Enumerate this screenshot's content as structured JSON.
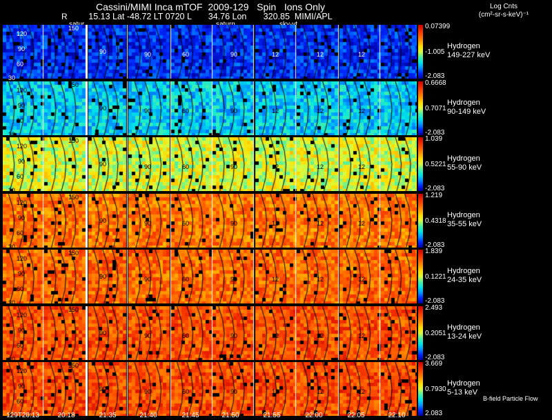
{
  "header": {
    "title": "Cassini/MIMI Inca mTOF  2009-129   Spin   Ions Only",
    "subtitle": "15.13 Lat -48.72 LT 0720 L       34.76 Lon       320.85  MIMI/APL",
    "r_label": "R",
    "units": "Log Cnts",
    "units2": "(cm²-sr-s-keV)⁻¹"
  },
  "markers": [
    "satur",
    "saturn",
    "sky-vt"
  ],
  "panels": [
    {
      "species": "Hydrogen",
      "energy": "149-227 keV",
      "max": "0.07399",
      "mid": "-1.005",
      "min": "-2.083",
      "level": 0.12
    },
    {
      "species": "Hydrogen",
      "energy": "90-149 keV",
      "max": "0.6668",
      "mid": "0.7071",
      "min": "-2.083",
      "level": 0.32
    },
    {
      "species": "Hydrogen",
      "energy": "55-90 keV",
      "max": "1.039",
      "mid": "0.5221",
      "min": "-2.083",
      "level": 0.56
    },
    {
      "species": "Hydrogen",
      "energy": "35-55 keV",
      "max": "1.219",
      "mid": "0.4318",
      "min": "-2.083",
      "level": 0.78
    },
    {
      "species": "Hydrogen",
      "energy": "24-35 keV",
      "max": "1.839",
      "mid": "0.1221",
      "min": "-2.083",
      "level": 0.8
    },
    {
      "species": "Hydrogen",
      "energy": "13-24 keV",
      "max": "2.493",
      "mid": "0.2051",
      "min": "-2.083",
      "level": 0.84
    },
    {
      "species": "Hydrogen",
      "energy": "5-13 keV",
      "max": "3.669",
      "mid": "0.7930",
      "min": "2.083",
      "level": 0.85
    }
  ],
  "time_ticks": [
    "129T20:13",
    "20:18",
    "21:35",
    "21:40",
    "21:45",
    "21:50",
    "21:55",
    "22:00",
    "22:05",
    "22:10"
  ],
  "contour_labels": [
    "120",
    "90",
    "60",
    "150",
    "30",
    "12"
  ],
  "footer": "B-field Particle Flow"
}
